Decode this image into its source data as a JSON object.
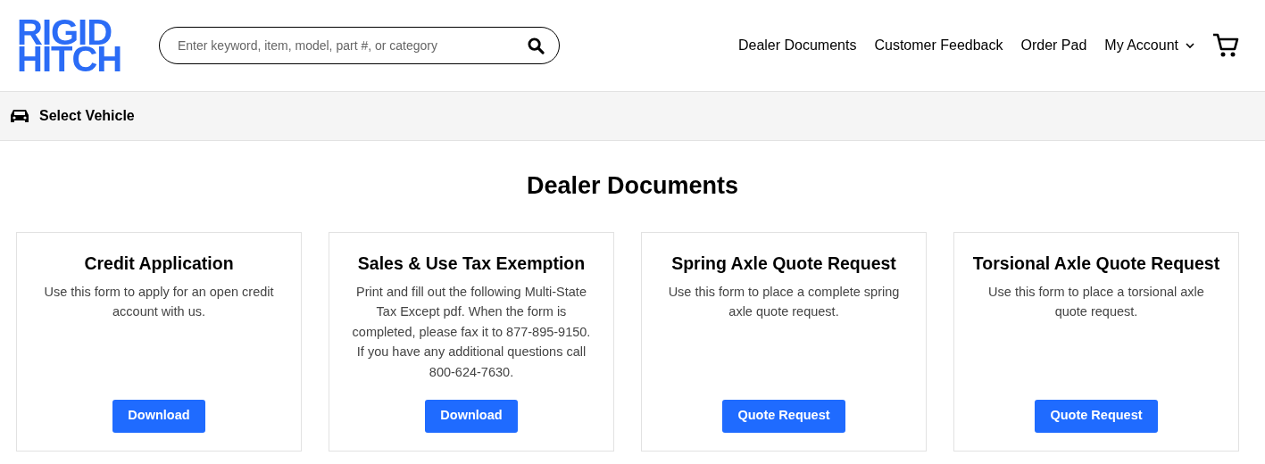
{
  "logo": {
    "lines": [
      "RIGID",
      "HITCH"
    ]
  },
  "search": {
    "placeholder": "Enter keyword, item, model, part #, or category"
  },
  "nav": [
    {
      "label": "Dealer Documents",
      "kind": "link"
    },
    {
      "label": "Customer Feedback",
      "kind": "link"
    },
    {
      "label": "Order Pad",
      "kind": "link"
    },
    {
      "label": "My Account",
      "kind": "dropdown"
    }
  ],
  "vehicle_bar": {
    "label": "Select Vehicle"
  },
  "heading": "Dealer Documents",
  "cards": [
    {
      "title": "Credit Application",
      "text": "Use this form to apply for an open credit account with us.",
      "button": "Download"
    },
    {
      "title": "Sales & Use Tax Exemption",
      "text": "Print and fill out the following Multi-State Tax Except pdf. When the form is completed, please fax it to 877-895-9150. If you have any additional questions call 800-624-7630.",
      "button": "Download"
    },
    {
      "title": "Spring Axle Quote Request",
      "text": "Use this form to place a complete spring axle quote request.",
      "button": "Quote Request"
    },
    {
      "title": "Torsional Axle Quote Request",
      "text": "Use this form to place a torsional axle quote request.",
      "button": "Quote Request"
    }
  ]
}
